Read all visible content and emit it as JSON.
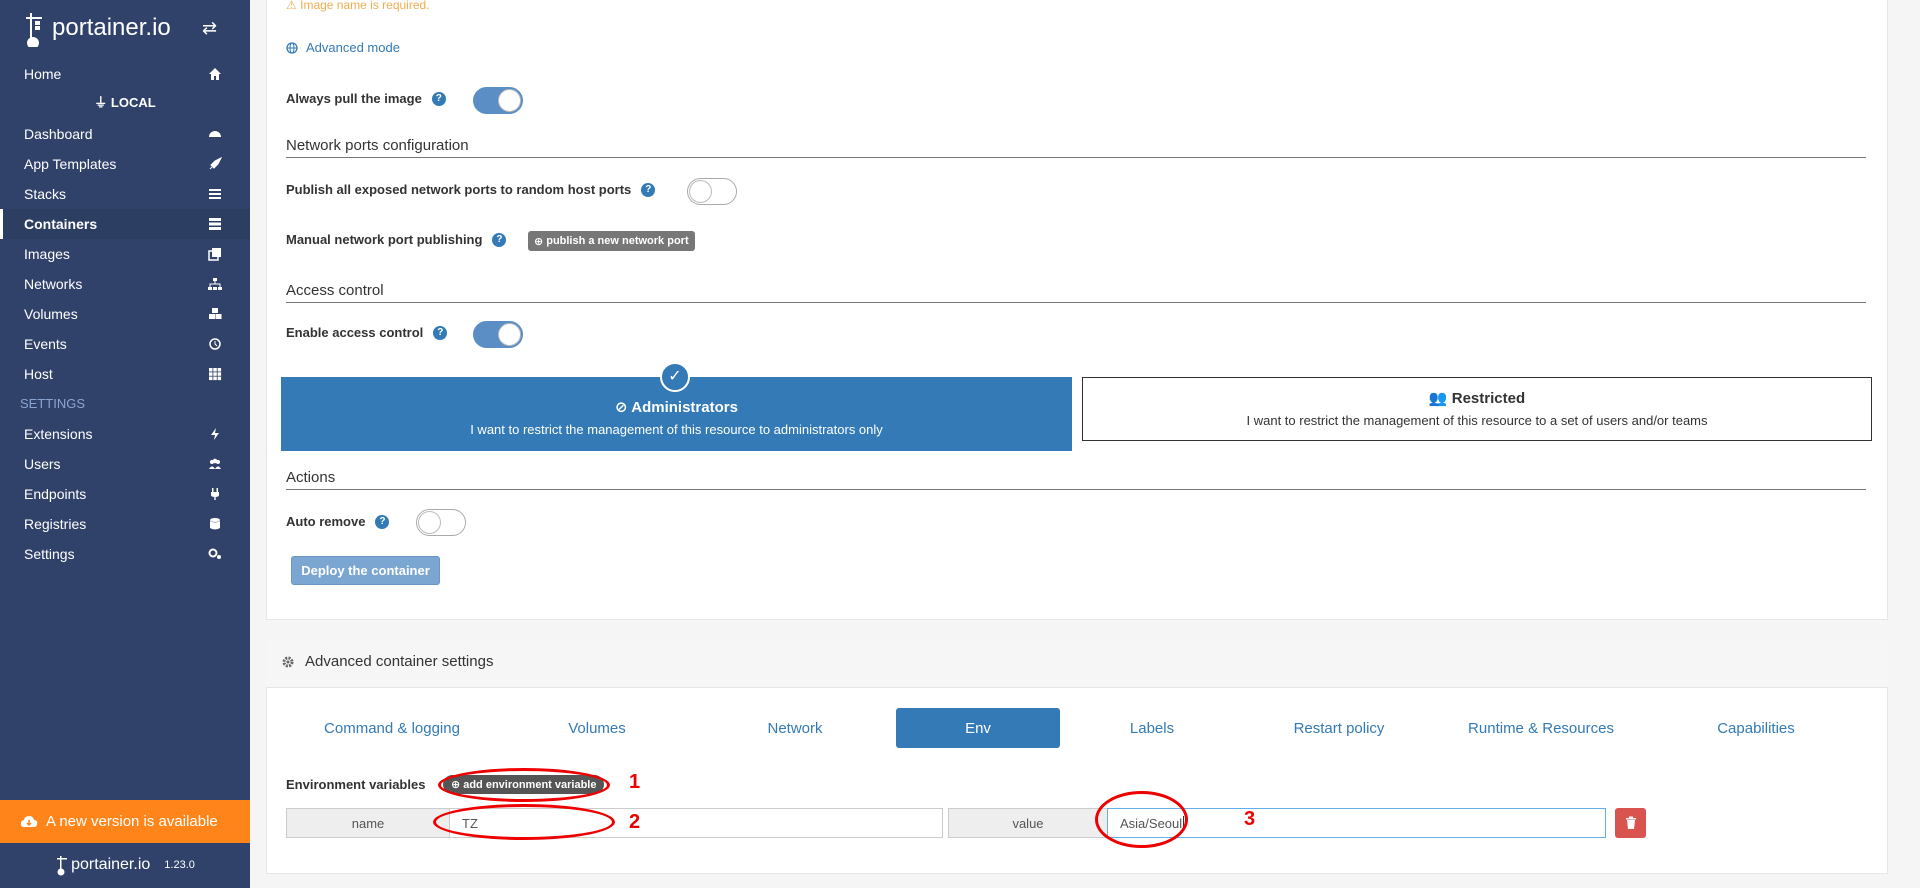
{
  "sidebar": {
    "brand": "portainer.io",
    "endpoint": "LOCAL",
    "items": [
      {
        "label": "Home",
        "icon": "home-icon"
      },
      {
        "label": "Dashboard",
        "icon": "dashboard-icon"
      },
      {
        "label": "App Templates",
        "icon": "rocket-icon"
      },
      {
        "label": "Stacks",
        "icon": "list-icon"
      },
      {
        "label": "Containers",
        "icon": "server-icon"
      },
      {
        "label": "Images",
        "icon": "clone-icon"
      },
      {
        "label": "Networks",
        "icon": "sitemap-icon"
      },
      {
        "label": "Volumes",
        "icon": "cubes-icon"
      },
      {
        "label": "Events",
        "icon": "history-icon"
      },
      {
        "label": "Host",
        "icon": "th-icon"
      }
    ],
    "settings_heading": "SETTINGS",
    "settings_items": [
      {
        "label": "Extensions",
        "icon": "bolt-icon"
      },
      {
        "label": "Users",
        "icon": "users-icon"
      },
      {
        "label": "Endpoints",
        "icon": "plug-icon"
      },
      {
        "label": "Registries",
        "icon": "database-icon"
      },
      {
        "label": "Settings",
        "icon": "cogs-icon"
      }
    ],
    "update_notice": "A new version is available",
    "footer_brand": "portainer.io",
    "version": "1.23.0"
  },
  "form": {
    "image_warning": "Image name is required.",
    "advanced_mode": "Advanced mode",
    "always_pull_label": "Always pull the image",
    "always_pull": true,
    "network_section": "Network ports configuration",
    "publish_all_label": "Publish all exposed network ports to random host ports",
    "publish_all": false,
    "manual_publish_label": "Manual network port publishing",
    "publish_port_button": "publish a new network port",
    "access_section": "Access control",
    "enable_access_label": "Enable access control",
    "enable_access": true,
    "admin_title": "Administrators",
    "admin_desc": "I want to restrict the management of this resource to administrators only",
    "restricted_title": "Restricted",
    "restricted_desc": "I want to restrict the management of this resource to a set of users and/or teams",
    "actions_section": "Actions",
    "auto_remove_label": "Auto remove",
    "auto_remove": false,
    "deploy_button": "Deploy the container"
  },
  "advanced": {
    "title": "Advanced container settings",
    "tabs": [
      "Command & logging",
      "Volumes",
      "Network",
      "Env",
      "Labels",
      "Restart policy",
      "Runtime & Resources",
      "Capabilities"
    ],
    "active_tab": "Env",
    "env_label": "Environment variables",
    "add_env_button": "add environment variable",
    "env": {
      "name_addon": "name",
      "name_value": "TZ",
      "value_addon": "value",
      "value_value": "Asia/Seoul"
    }
  },
  "annotations": [
    "1",
    "2",
    "3"
  ],
  "colors": {
    "sidebar": "#30426a",
    "primary": "#337ab7",
    "update": "#ff851b",
    "annotation": "#e00000",
    "danger": "#d9534f"
  }
}
